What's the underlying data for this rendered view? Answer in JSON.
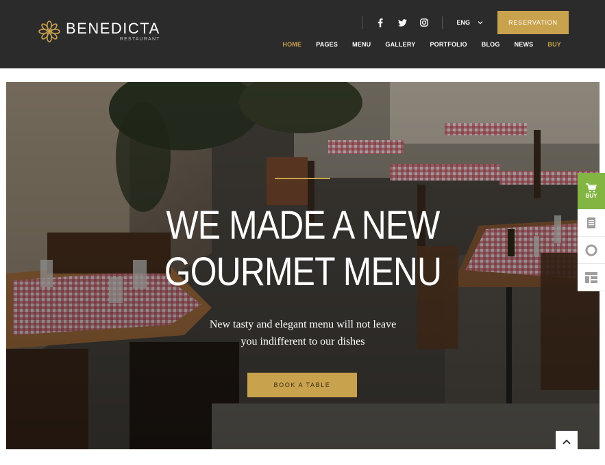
{
  "brand": {
    "name": "BENEDICTA",
    "subtitle": "RESTAURANT",
    "accent": "#c9a24d"
  },
  "header": {
    "social_icons": [
      "facebook-icon",
      "twitter-icon",
      "instagram-icon"
    ],
    "language": "ENG",
    "reservation_label": "RESERVATION",
    "nav": [
      {
        "label": "HOME",
        "active": true
      },
      {
        "label": "PAGES",
        "active": false
      },
      {
        "label": "MENU",
        "active": false
      },
      {
        "label": "GALLERY",
        "active": false
      },
      {
        "label": "PORTFOLIO",
        "active": false
      },
      {
        "label": "BLOG",
        "active": false
      },
      {
        "label": "NEWS",
        "active": false
      },
      {
        "label": "BUY",
        "active": false
      }
    ]
  },
  "hero": {
    "title_line1": "WE MADE A NEW",
    "title_line2": "GOURMET MENU",
    "subtitle_line1": "New tasty and elegant menu will not leave",
    "subtitle_line2": "you indifferent to our dishes",
    "button_label": "BOOK A TABLE"
  },
  "side_widget": {
    "buy_label": "BUY",
    "buy_color": "#82b541",
    "icons": [
      "document-icon",
      "lifebuoy-icon",
      "layout-icon"
    ]
  },
  "back_to_top_icon": "chevron-up-icon"
}
